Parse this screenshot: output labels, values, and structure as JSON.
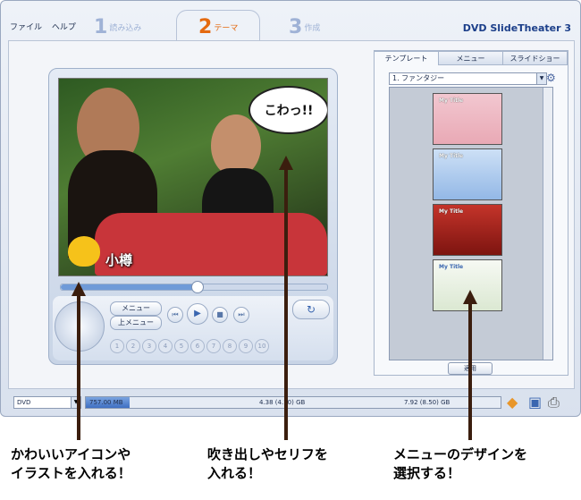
{
  "menu": {
    "file": "ファイル",
    "help": "ヘルプ"
  },
  "app_title": "DVD SlideTheater 3",
  "steps": [
    {
      "num": "1",
      "label": "読み込み"
    },
    {
      "num": "2",
      "label": "テーマ"
    },
    {
      "num": "3",
      "label": "作成"
    }
  ],
  "preview": {
    "bubble_text": "こわっ!!",
    "duck_label": "小樽",
    "seek_progress": 0.51,
    "menu_button": "メニュー",
    "top_menu_button": "上メニュー",
    "number_keys": [
      "1",
      "2",
      "3",
      "4",
      "5",
      "6",
      "7",
      "8",
      "9",
      "10"
    ]
  },
  "panel": {
    "tabs": [
      "テンプレート",
      "メニュー",
      "スライドショー"
    ],
    "template_select": "1. ファンタジー",
    "thumbnails": [
      {
        "title": "My Title",
        "color": "#d9a6b5"
      },
      {
        "title": "My Title",
        "color": "#a8c6ea"
      },
      {
        "title": "My Title",
        "color": "#a8241e"
      },
      {
        "title": "My Title",
        "color": "#e7efe2"
      }
    ],
    "apply_button": "適用"
  },
  "bottom": {
    "disc_type": "DVD",
    "used": "757.00 MB",
    "mark1": "4.38 (4.70) GB",
    "mark2": "7.92 (8.50) GB",
    "used_fraction": 0.105
  },
  "annotations": [
    "かわいいアイコンや\nイラストを入れる！",
    "吹き出しやセリフを\n入れる！",
    "メニューのデザインを\n選択する！"
  ],
  "colors": {
    "accent": "#e46a10",
    "arrow": "#3b1e0e",
    "brand": "#1c3f8a"
  }
}
